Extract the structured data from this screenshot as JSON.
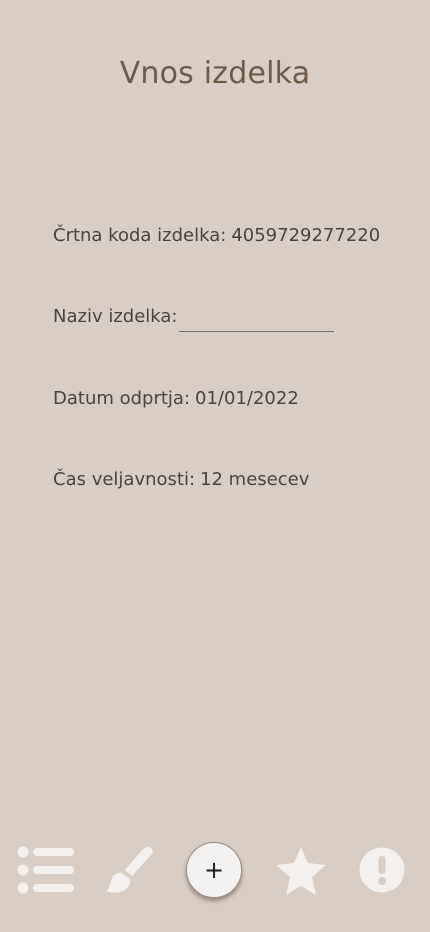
{
  "page": {
    "title": "Vnos izdelka"
  },
  "form": {
    "barcode": {
      "label": "Črtna koda izdelka:",
      "value": "4059729277220"
    },
    "name": {
      "label": "Naziv izdelka:",
      "value": "",
      "placeholder": ""
    },
    "open_date": {
      "label": "Datum odprtja:",
      "value": "01/01/2022"
    },
    "expiry": {
      "label": "Čas veljavnosti:",
      "value": "12 mesecev"
    }
  },
  "nav": {
    "items": [
      {
        "icon": "list-icon"
      },
      {
        "icon": "brush-icon"
      },
      {
        "icon": "plus-icon",
        "label": "+"
      },
      {
        "icon": "star-icon"
      },
      {
        "icon": "alert-icon"
      }
    ]
  },
  "colors": {
    "background": "#d8cec5",
    "title": "#6e5a4a",
    "text": "#4a4340",
    "icon": "#f2efec",
    "add_button": "#f3f1ef"
  }
}
